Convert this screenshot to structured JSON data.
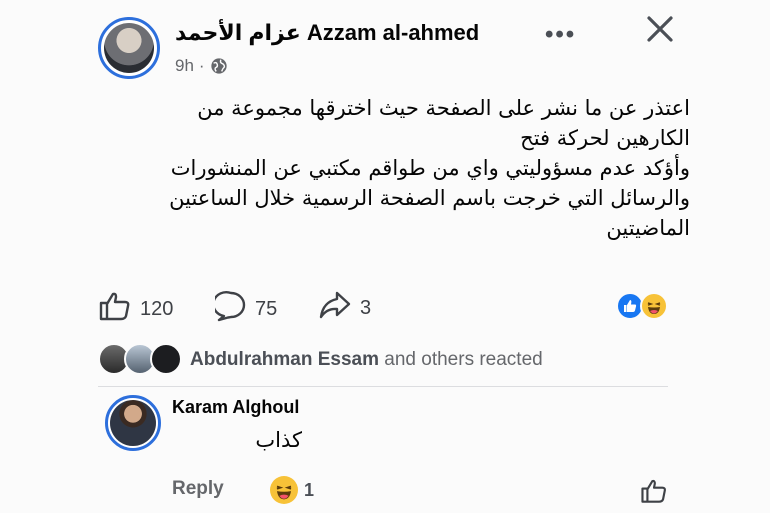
{
  "post": {
    "author_name": "عزام الأحمد Azzam al-ahmed",
    "time": "9h",
    "separator": "·",
    "privacy_icon": "globe-icon",
    "more_label": "•••",
    "text_lines": [
      "اعتذر عن ما نشر على الصفحة حيث اخترقها مجموعة من",
      "الكارهين لحركة فتح",
      "وأؤكد عدم مسؤوليتي واي من طواقم مكتبي عن المنشورات",
      "والرسائل التي خرجت باسم الصفحة الرسمية خلال الساعتين",
      "الماضيتين"
    ]
  },
  "actions": {
    "like_count": "120",
    "comment_count": "75",
    "share_count": "3"
  },
  "reactions": {
    "reactor_name": "Abdulrahman Essam",
    "reacted_suffix": " and others reacted"
  },
  "comment": {
    "author": "Karam Alghoul",
    "text": "كذاب",
    "reply_label": "Reply",
    "reaction_count": "1"
  },
  "colors": {
    "accent_blue": "#1877f2",
    "avatar_ring": "#2d6fdc",
    "haha_yellow": "#f7c238",
    "muted_text": "#65676b"
  }
}
